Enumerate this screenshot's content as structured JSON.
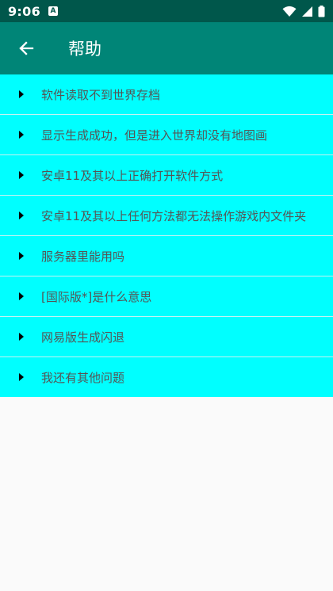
{
  "status_bar": {
    "time": "9:06",
    "notification_icon": "A"
  },
  "app_bar": {
    "title": "帮助",
    "back_icon": "arrow-left-icon"
  },
  "help_items": [
    {
      "label": "软件读取不到世界存档"
    },
    {
      "label": "显示生成成功，但是进入世界却没有地图画"
    },
    {
      "label": "安卓11及其以上正确打开软件方式"
    },
    {
      "label": "安卓11及其以上任何方法都无法操作游戏内文件夹"
    },
    {
      "label": "服务器里能用吗"
    },
    {
      "label": "[国际版*]是什么意思"
    },
    {
      "label": "网易版生成闪退"
    },
    {
      "label": "我还有其他问题"
    }
  ],
  "colors": {
    "status_bar": "#00574b",
    "app_bar": "#008577",
    "list_background": "#00ffff",
    "page_background": "#fafafa"
  }
}
